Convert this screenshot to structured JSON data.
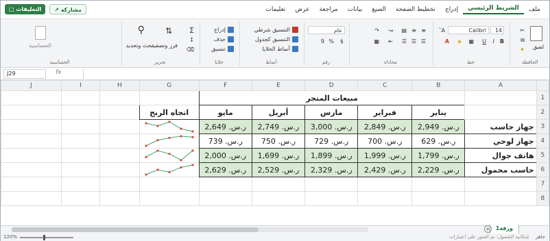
{
  "ribbon": {
    "tabs": [
      "ملف",
      "الشريط الرئيسي",
      "إدراج",
      "تخطيط الصفحة",
      "الصيغ",
      "بيانات",
      "مراجعة",
      "عرض",
      "تعليمات"
    ],
    "active_tab_index": 1,
    "share_label": "مشاركة",
    "comments_label": "التعليقات",
    "font_name": "Calibri",
    "font_size": "14",
    "number_format": "عام",
    "paste_label": "لصق",
    "format_insert": "إدراج",
    "format_delete": "حذف",
    "format_cell": "تنسيق",
    "cond_format": "التنسيق شرطي",
    "format_table": "التنسيق كجدول",
    "cell_styles": "أنماط الخلايا",
    "sort_filter": "فرز وتصفية",
    "find_select": "بحث وتحديد",
    "group_clipboard": "الحافظة",
    "group_font": "خط",
    "group_alignment": "محاذاة",
    "group_number": "رقم",
    "group_styles": "أنماط",
    "group_cells": "خلايا",
    "group_editing": "تحرير",
    "group_sensitivity": "الحساسية"
  },
  "formula_bar": {
    "name_box": "J29",
    "fx": "fx"
  },
  "sheet": {
    "columns": [
      "A",
      "B",
      "C",
      "D",
      "E",
      "F",
      "G",
      "H",
      "I",
      "J"
    ],
    "rows": [
      "1",
      "2",
      "3",
      "4",
      "5",
      "6",
      "7",
      "8"
    ],
    "title": "مبيعات المتجر",
    "months": [
      "يناير",
      "فبراير",
      "مارس",
      "أبريل",
      "مايو"
    ],
    "trend_header": "اتجاه الربح",
    "products": [
      {
        "name": "جهاز حاسب",
        "values": [
          "ر.س. 2,949",
          "ر.س. 2,849",
          "ر.س. 3,000",
          "ر.س. 2,749",
          "ر.س. 2,649"
        ]
      },
      {
        "name": "جهاز لوحي",
        "values": [
          "ر.س. 629",
          "ر.س. 700",
          "ر.س. 729",
          "ر.س. 750",
          "ر.س. 739"
        ]
      },
      {
        "name": "هاتف جوال",
        "values": [
          "ر.س. 1,799",
          "ر.س. 1,999",
          "ر.س. 1,899",
          "ر.س. 1,699",
          "ر.س. 2,000"
        ]
      },
      {
        "name": "حاسب محمول",
        "values": [
          "ر.س. 2,229",
          "ر.س. 2,429",
          "ر.س. 2,329",
          "ر.س. 2,529",
          "ر.س. 2,629"
        ]
      }
    ],
    "sparkline_values": [
      [
        2949,
        2849,
        3000,
        2749,
        2649
      ],
      [
        629,
        700,
        729,
        750,
        739
      ],
      [
        1799,
        1999,
        1899,
        1699,
        2000
      ],
      [
        2229,
        2429,
        2329,
        2529,
        2629
      ]
    ],
    "sheet_tab": "ورقة1"
  },
  "status": {
    "zoom": "120%",
    "message": "إمكانية الشمول: تم العثور على اعتبارات",
    "ready": "جاهز"
  },
  "colors": {
    "accent": "#1e6b3a",
    "data_fill": "#d8ead2",
    "sparkline": "#e0483a",
    "pointer": "#1a9ee0"
  }
}
